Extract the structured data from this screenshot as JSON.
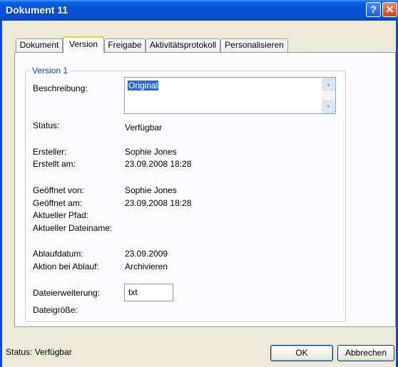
{
  "window": {
    "title": "Dokument 11",
    "help_glyph": "?",
    "close_glyph": "✕"
  },
  "tabs": [
    {
      "label": "Dokument",
      "active": false
    },
    {
      "label": "Version",
      "active": true
    },
    {
      "label": "Freigabe",
      "active": false
    },
    {
      "label": "Aktivitätsprotokoll",
      "active": false
    },
    {
      "label": "Personalisieren",
      "active": false
    }
  ],
  "version_group": {
    "legend": "Version 1",
    "description_label": "Beschreibung:",
    "description_value": "Original",
    "status_label": "Status:",
    "status_value": "Verfügbar",
    "creator_label": "Ersteller:",
    "creator_value": "Sophie Jones",
    "created_label": "Erstellt am:",
    "created_value": "23.09.2008 18:28",
    "opened_by_label": "Geöffnet von:",
    "opened_by_value": "Sophie Jones",
    "opened_at_label": "Geöffnet am:",
    "opened_at_value": "23.09.2008 18:28",
    "current_path_label": "Aktueller Pfad:",
    "current_filename_label": "Aktueller Dateiname:",
    "expiry_label": "Ablaufdatum:",
    "expiry_value": "23.09.2009",
    "expiry_action_label": "Aktion bei Ablauf:",
    "expiry_action_value": "Archivieren",
    "extension_label": "Dateierweiterung:",
    "extension_value": "txt",
    "filesize_label": "Dateigröße:"
  },
  "footer": {
    "status": "Status: Verfügbar",
    "ok_label": "OK",
    "cancel_label": "Abbrechen"
  }
}
